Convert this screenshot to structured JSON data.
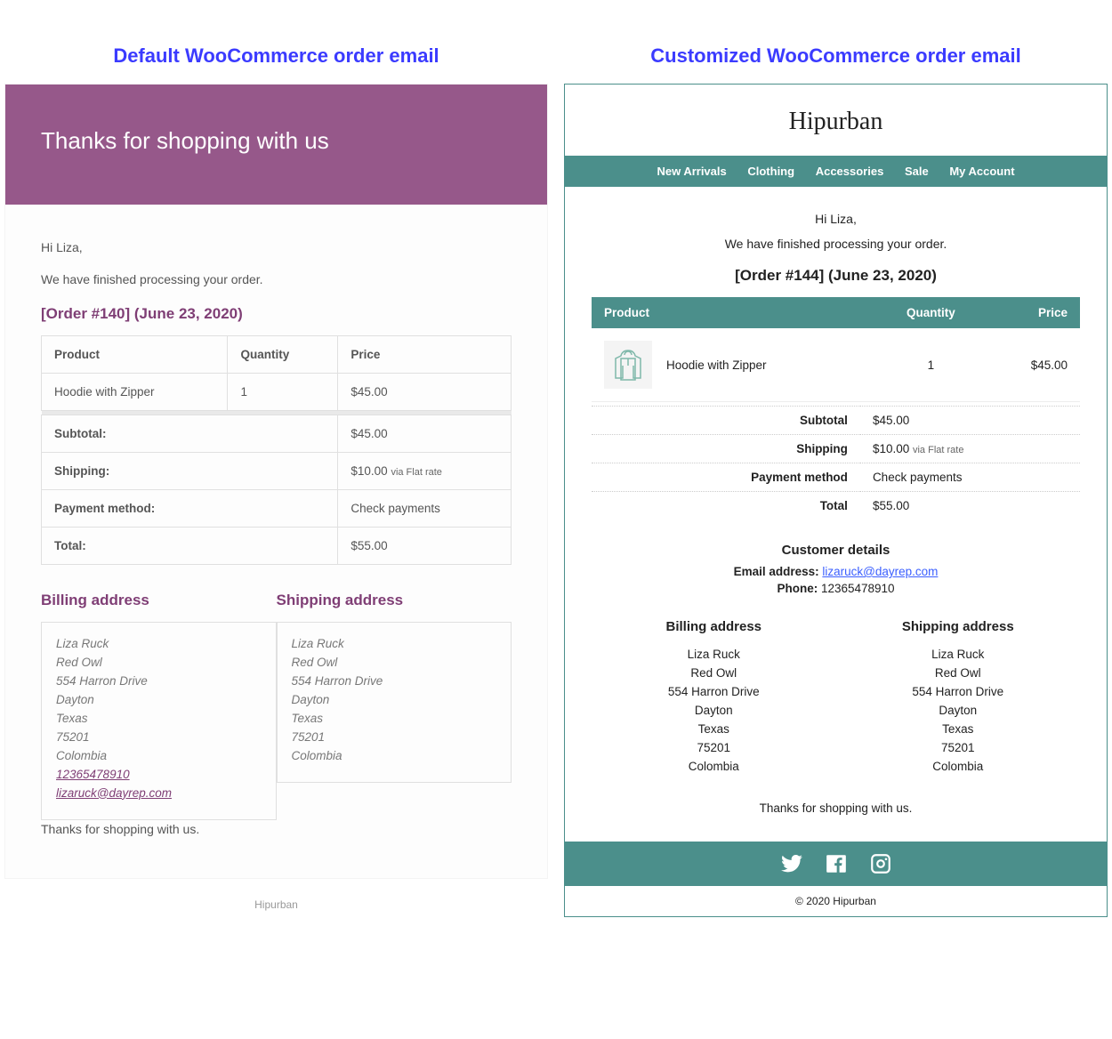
{
  "captions": {
    "left": "Default  WooCommerce order email",
    "right": "Customized WooCommerce order email"
  },
  "default": {
    "header": "Thanks for shopping with us",
    "greeting": "Hi Liza,",
    "intro": "We have finished processing your order.",
    "order_title": "[Order #140] (June 23, 2020)",
    "table": {
      "h_product": "Product",
      "h_qty": "Quantity",
      "h_price": "Price",
      "item_name": "Hoodie with Zipper",
      "item_qty": "1",
      "item_price": "$45.00",
      "subtotal_k": "Subtotal:",
      "subtotal_v": "$45.00",
      "shipping_k": "Shipping:",
      "shipping_v": "$10.00 ",
      "shipping_via": "via Flat rate",
      "pay_k": "Payment method:",
      "pay_v": "Check payments",
      "total_k": "Total:",
      "total_v": "$55.00"
    },
    "billing": {
      "h": "Billing address",
      "name": "Liza Ruck",
      "company": "Red Owl",
      "street": "554 Harron Drive",
      "city": "Dayton",
      "state": "Texas",
      "zip": "75201",
      "country": "Colombia",
      "phone": "12365478910",
      "email": "lizaruck@dayrep.com"
    },
    "shipping": {
      "h": "Shipping address",
      "name": "Liza Ruck",
      "company": "Red Owl",
      "street": "554 Harron Drive",
      "city": "Dayton",
      "state": "Texas",
      "zip": "75201",
      "country": "Colombia"
    },
    "footer_inside": "Thanks for shopping with us.",
    "brand": "Hipurban"
  },
  "custom": {
    "brand": "Hipurban",
    "nav": {
      "a": "New Arrivals",
      "b": "Clothing",
      "c": "Accessories",
      "d": "Sale",
      "e": "My Account"
    },
    "greeting": "Hi Liza,",
    "intro": "We have finished processing your order.",
    "order_title": "[Order #144] (June 23, 2020)",
    "table": {
      "h_product": "Product",
      "h_qty": "Quantity",
      "h_price": "Price",
      "item_name": "Hoodie with Zipper",
      "item_qty": "1",
      "item_price": "$45.00"
    },
    "summary": {
      "subtotal_k": "Subtotal",
      "subtotal_v": "$45.00",
      "shipping_k": "Shipping",
      "shipping_v": "$10.00 ",
      "shipping_via": "via Flat rate",
      "pay_k": "Payment method",
      "pay_v": "Check payments",
      "total_k": "Total",
      "total_v": "$55.00"
    },
    "details": {
      "h": "Customer details",
      "email_k": "Email address: ",
      "email_v": "lizaruck@dayrep.com",
      "phone_k": "Phone: ",
      "phone_v": "12365478910"
    },
    "billing": {
      "h": "Billing address",
      "name": "Liza Ruck",
      "company": "Red Owl",
      "street": "554 Harron Drive",
      "city": "Dayton",
      "state": "Texas",
      "zip": "75201",
      "country": "Colombia"
    },
    "shipping": {
      "h": "Shipping address",
      "name": "Liza Ruck",
      "company": "Red Owl",
      "street": "554 Harron Drive",
      "city": "Dayton",
      "state": "Texas",
      "zip": "75201",
      "country": "Colombia"
    },
    "thanks": "Thanks for shopping with us.",
    "copyright": "© 2020 Hipurban"
  }
}
